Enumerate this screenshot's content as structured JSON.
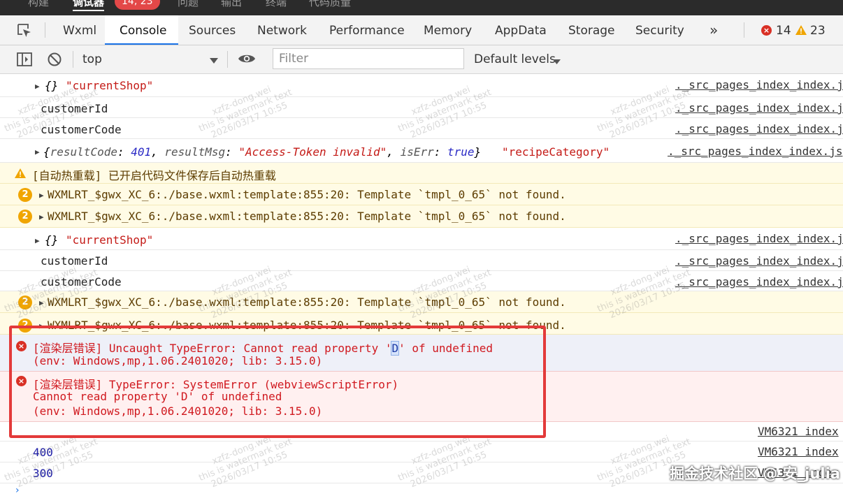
{
  "topbar": {
    "items": [
      "构建",
      "调试器",
      "问题",
      "输出",
      "终端",
      "代码质量"
    ],
    "badge": "14, 23"
  },
  "tabs": {
    "items": [
      "Wxml",
      "Console",
      "Sources",
      "Network",
      "Performance",
      "Memory",
      "AppData",
      "Storage",
      "Security"
    ],
    "more": "»",
    "errors_count": "14",
    "warnings_count": "23"
  },
  "toolbar": {
    "context": "top",
    "filter_placeholder": "Filter",
    "levels": "Default levels"
  },
  "console": {
    "src1": "._src_pages_index_index.j",
    "src_obj": "._src_pages_index_index.js",
    "src_vm": "VM6321 index",
    "row_obj_current": "\"currentShop\"",
    "row_obj_brace": "{}",
    "customer_id": "customerId",
    "customer_code": "customerCode",
    "result_obj": {
      "k1": "resultCode",
      "v1": "401",
      "k2": "resultMsg",
      "v2": "\"Access-Token invalid\"",
      "k3": "isErr",
      "v3": "true",
      "label": "\"recipeCategory\""
    },
    "hotreload": "[自动热重载] 已开启代码文件保存后自动热重载",
    "wxml_warn_count": "2",
    "wxml_warn": "WXMLRT_$gwx_XC_6:./base.wxml:template:855:20: Template `tmpl_0_65` not found.",
    "err1_line1_a": "[渲染层错误] Uncaught TypeError: Cannot read property '",
    "err1_line1_d": "D",
    "err1_line1_b": "' of undefined",
    "err1_line2": "(env: Windows,mp,1.06.2401020; lib: 3.15.0)",
    "err2_line1": "[渲染层错误] TypeError: SystemError (webviewScriptError)",
    "err2_line2": "Cannot read property 'D' of undefined",
    "err2_line3": "(env: Windows,mp,1.06.2401020; lib: 3.15.0)",
    "val_400": "400",
    "val_300": "300"
  },
  "watermark": {
    "line1": "xzfz-dong.wei",
    "line2": "this is watermark text",
    "line3": "2026/03/17 10:55"
  },
  "signature": "掘金技术社区 @ 安_julia",
  "colors": {
    "error": "#d0191f",
    "warning_bg": "#fffbe5",
    "highlight_border": "#e33a3a",
    "accent": "#1a73e8"
  }
}
